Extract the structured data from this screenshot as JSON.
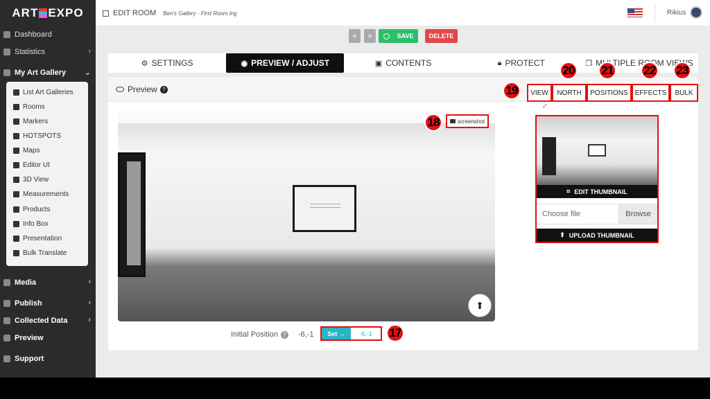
{
  "app": {
    "logo_left": "ART",
    "logo_right": "EXPO"
  },
  "topbar": {
    "page_title": "EDIT ROOM",
    "room_subtitle": "Ben's Gallery - First Room lng",
    "user_name": "Rikius"
  },
  "sidebar": {
    "items": [
      {
        "label": "Dashboard",
        "icon": "dashboard-icon"
      },
      {
        "label": "Statistics",
        "icon": "statistics-icon"
      },
      {
        "label": "My Art Gallery",
        "icon": "gallery-icon"
      },
      {
        "label": "Media",
        "icon": "media-icon"
      },
      {
        "label": "Publish",
        "icon": "publish-icon"
      },
      {
        "label": "Collected Data",
        "icon": "collected-data-icon"
      },
      {
        "label": "Preview",
        "icon": "preview-icon"
      },
      {
        "label": "Support",
        "icon": "support-icon"
      }
    ],
    "submenu": [
      {
        "label": "List Art Galleries",
        "icon": "list-icon"
      },
      {
        "label": "Rooms",
        "icon": "rooms-icon"
      },
      {
        "label": "Markers",
        "icon": "markers-icon"
      },
      {
        "label": "HOTSPOTS",
        "icon": "hotspots-icon"
      },
      {
        "label": "Maps",
        "icon": "maps-icon"
      },
      {
        "label": "Editor UI",
        "icon": "editor-ui-icon"
      },
      {
        "label": "3D View",
        "icon": "cube-icon"
      },
      {
        "label": "Measurements",
        "icon": "measurements-icon"
      },
      {
        "label": "Products",
        "icon": "cart-icon"
      },
      {
        "label": "Info Box",
        "icon": "info-icon"
      },
      {
        "label": "Presentation",
        "icon": "presentation-icon"
      },
      {
        "label": "Bulk Translate",
        "icon": "translate-icon"
      }
    ]
  },
  "toolbar": {
    "prev_label": "<",
    "next_label": ">",
    "save_label": "SAVE",
    "delete_label": "DELETE"
  },
  "tabs": [
    {
      "label": "SETTINGS",
      "icon": "gears-icon"
    },
    {
      "label": "PREVIEW / ADJUST",
      "icon": "eye-icon"
    },
    {
      "label": "CONTENTS",
      "icon": "images-icon"
    },
    {
      "label": "PROTECT",
      "icon": "lock-icon"
    },
    {
      "label": "MULTIPLE ROOM VIEWS",
      "icon": "copy-icon"
    }
  ],
  "preview": {
    "title": "Preview",
    "screenshot_label": "screenshot",
    "initial_position_label": "Initial Position",
    "initial_position_value": "-6,-1",
    "set_label": "Set →",
    "set_input_value": "-6,-1"
  },
  "subtabs": [
    "VIEW",
    "NORTH",
    "POSITIONS",
    "EFFECTS",
    "BULK"
  ],
  "thumbnail": {
    "edit_label": "EDIT THUMBNAIL",
    "file_placeholder": "Choose file",
    "browse_label": "Browse",
    "upload_label": "UPLOAD THUMBNAIL"
  },
  "markers": [
    "17",
    "18",
    "19",
    "20",
    "21",
    "22",
    "23"
  ],
  "colors": {
    "accent_red": "#e21010",
    "save_green": "#2bbf6a",
    "delete_red": "#e04848",
    "set_teal": "#2ab4c4",
    "sidebar_bg": "#2b2b2b"
  }
}
